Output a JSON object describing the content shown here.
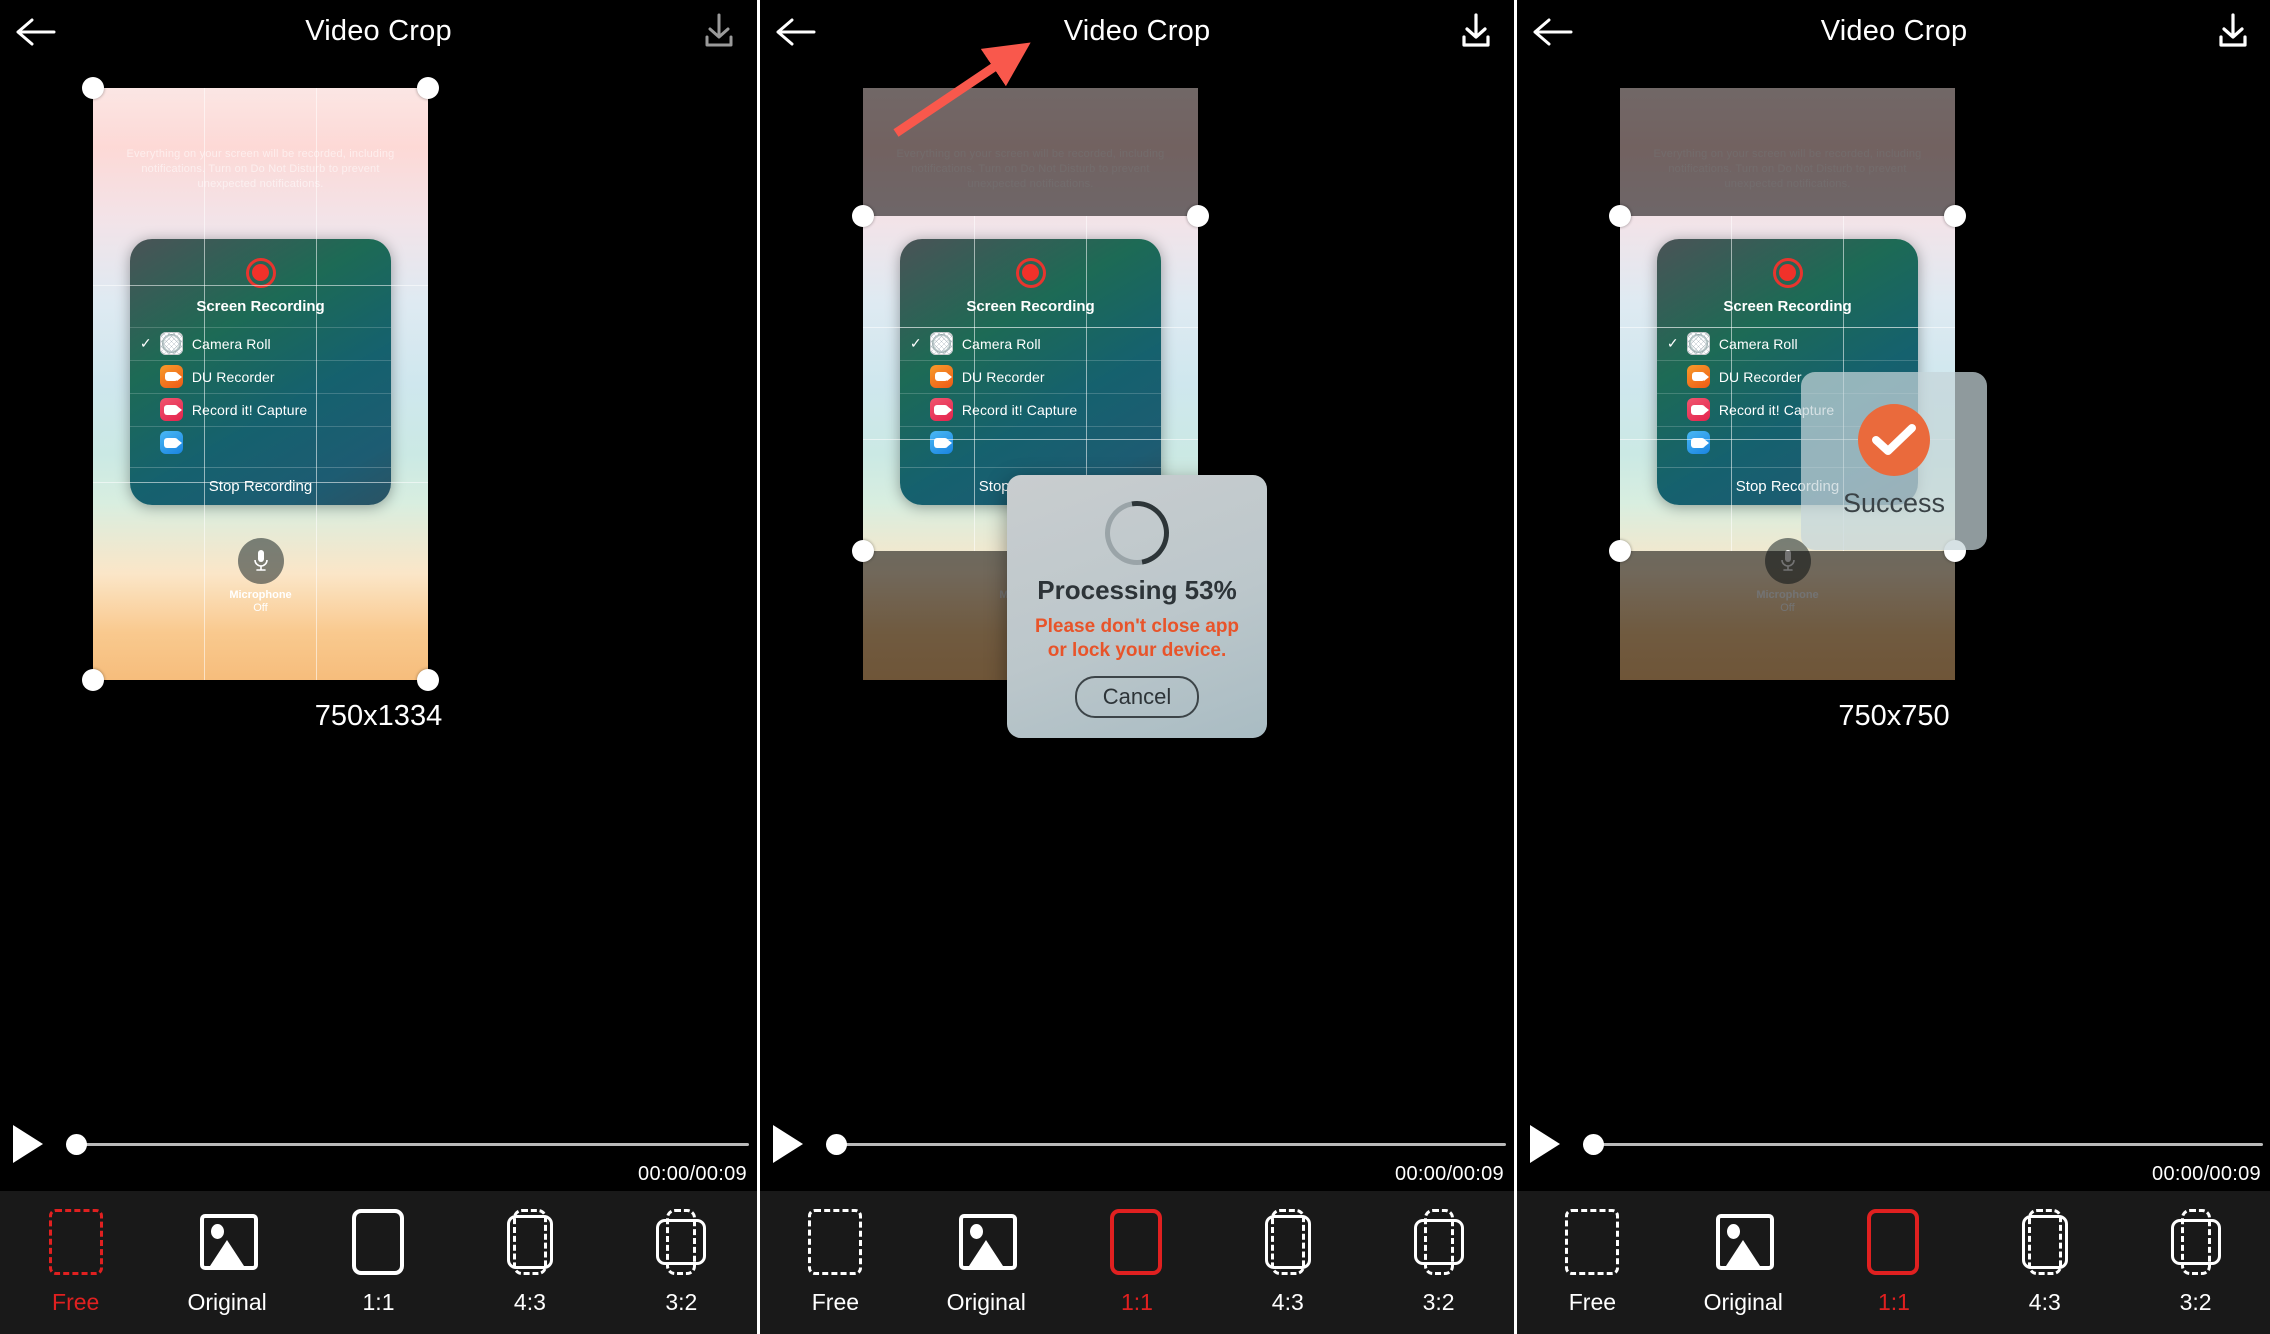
{
  "header": {
    "title": "Video Crop",
    "back_icon": "back-arrow-icon",
    "download_icon": "download-icon"
  },
  "video_content": {
    "wallpaper_notice": "Everything on your screen will be recorded, including notifications. Turn on Do Not Disturb to prevent unexpected notifications.",
    "sheet_title": "Screen Recording",
    "record_icon": "record-dot-icon",
    "apps": [
      {
        "label": "Camera Roll",
        "icon": "camera-roll-icon",
        "checked": "✓"
      },
      {
        "label": "DU Recorder",
        "icon": "du-recorder-icon",
        "checked": ""
      },
      {
        "label": "Record it! Capture",
        "icon": "record-it-icon",
        "checked": ""
      }
    ],
    "stop_recording": "Stop Recording",
    "microphone_label": "Microphone",
    "microphone_state": "Off",
    "microphone_icon": "microphone-icon"
  },
  "panels": [
    {
      "id": "panel-free",
      "dimensions": "750x1334",
      "time": "00:00/00:09",
      "play_icon": "play-icon",
      "selected_ratio": "Free",
      "dialog": "none",
      "annotation_arrow": false
    },
    {
      "id": "panel-processing",
      "dimensions": "750x750",
      "time": "00:00/00:09",
      "play_icon": "play-icon",
      "selected_ratio": "1:1",
      "dialog": "processing",
      "annotation_arrow": true
    },
    {
      "id": "panel-success",
      "dimensions": "750x750",
      "time": "00:00/00:09",
      "play_icon": "play-icon",
      "selected_ratio": "1:1",
      "dialog": "success",
      "annotation_arrow": false
    }
  ],
  "ratios": [
    {
      "label": "Free",
      "icon": "free-crop-icon"
    },
    {
      "label": "Original",
      "icon": "original-image-icon"
    },
    {
      "label": "1:1",
      "icon": "square-crop-icon"
    },
    {
      "label": "4:3",
      "icon": "four-three-crop-icon"
    },
    {
      "label": "3:2",
      "icon": "three-two-crop-icon"
    }
  ],
  "processing_dialog": {
    "title": "Processing 53%",
    "warning": "Please don't close app or lock your device.",
    "cancel_label": "Cancel",
    "spinner_icon": "loading-spinner-icon",
    "progress_percent": 53
  },
  "success_dialog": {
    "title": "Success",
    "check_icon": "check-circle-icon"
  },
  "colors": {
    "accent_red": "#e02020",
    "warning_orange": "#e8542a",
    "success_orange": "#ea6a3c",
    "arrow_red": "#f9584c",
    "background": "#000000",
    "toolbar_background": "#191919"
  }
}
